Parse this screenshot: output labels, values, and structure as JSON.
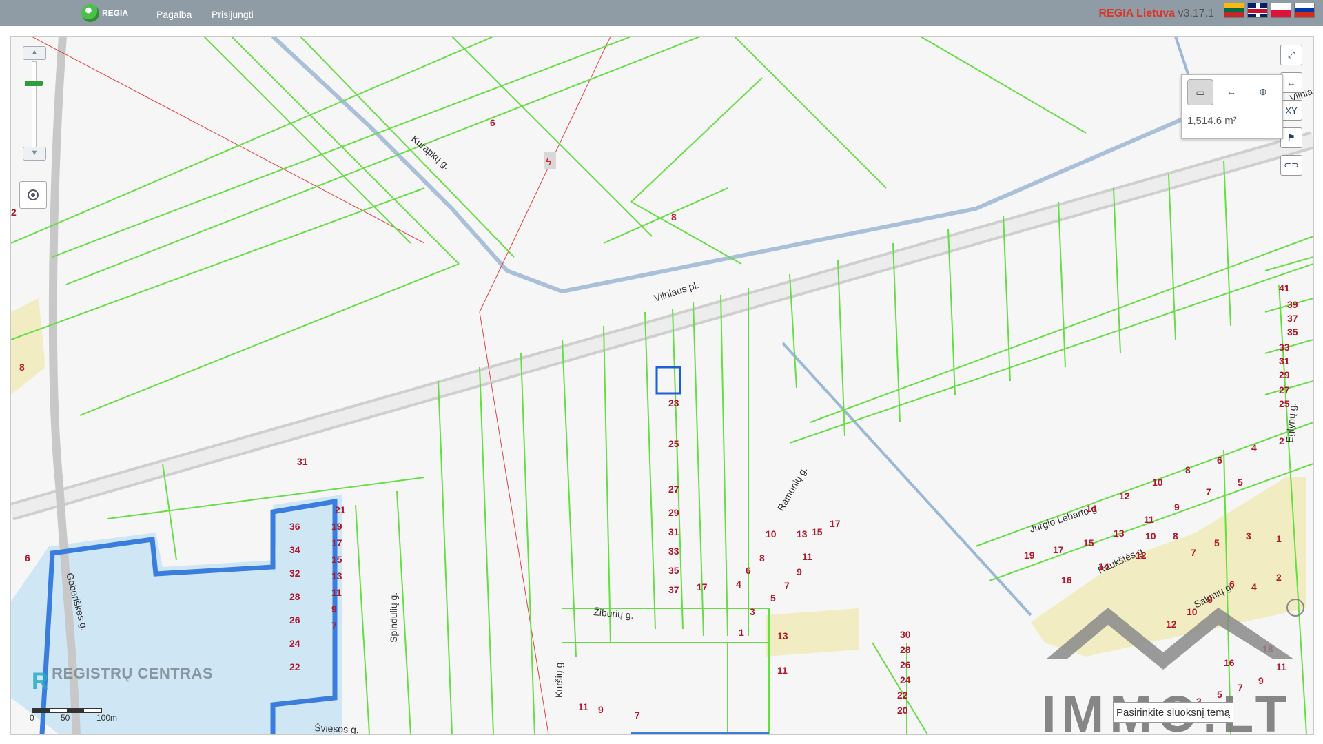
{
  "header": {
    "brand_label": "REGIA",
    "nav": {
      "help": "Pagalba",
      "login": "Prisijungti"
    },
    "app_name": "REGIA Lietuva",
    "version": "v3.17.1",
    "languages": [
      "lt",
      "en",
      "pl",
      "ru"
    ]
  },
  "map": {
    "streets": [
      "Vilniaus pl.",
      "Kurapkų g.",
      "Žiburių g.",
      "Ramunių g.",
      "Jurgio Lėbarto g.",
      "Raukštės g.",
      "Sakmių g.",
      "Spindulių g.",
      "Kuršių g.",
      "Šviesos g.",
      "Goberiškės g.",
      "Vilnia",
      "Eglynų g."
    ],
    "parcel_labels": [
      "6",
      "8",
      "31",
      "23",
      "25",
      "27",
      "29",
      "31",
      "33",
      "35",
      "37",
      "17",
      "21",
      "19",
      "17",
      "15",
      "13",
      "11",
      "9",
      "7",
      "36",
      "34",
      "32",
      "28",
      "26",
      "24",
      "22",
      "10",
      "13",
      "15",
      "17",
      "11",
      "8",
      "6",
      "4",
      "9",
      "7",
      "5",
      "3",
      "1",
      "13",
      "11",
      "30",
      "28",
      "26",
      "24",
      "22",
      "20",
      "41",
      "39",
      "37",
      "35",
      "33",
      "31",
      "29",
      "27",
      "25",
      "4",
      "2",
      "6",
      "8",
      "10",
      "12",
      "14",
      "5",
      "7",
      "9",
      "11",
      "13",
      "15",
      "17",
      "19",
      "16",
      "14",
      "12",
      "1",
      "3",
      "5",
      "7",
      "8",
      "10",
      "2",
      "4",
      "6",
      "8",
      "10",
      "12",
      "16",
      "18",
      "11",
      "9",
      "7",
      "5",
      "3",
      "1",
      "6",
      "8",
      "2",
      "11",
      "9",
      "7"
    ],
    "measure": {
      "area": "1,514.6 m²"
    },
    "scale": {
      "labels": [
        "0",
        "50",
        "100m"
      ]
    },
    "theme_select_value": "Pasirinkite sluoksnį temą",
    "watermarks": {
      "registru": "REGISTRŲ CENTRAS",
      "immo": "IMMO.LT"
    },
    "icons": {
      "zoom_in": "zoom-in-icon",
      "zoom_out": "zoom-out-icon",
      "locate": "locate-icon",
      "fullscreen": "fullscreen-icon",
      "measure_area": "measure-area-icon",
      "measure_distance": "measure-distance-icon",
      "coordinates": "xy-coordinates-icon",
      "flag": "flag-icon",
      "link": "link-icon"
    }
  }
}
